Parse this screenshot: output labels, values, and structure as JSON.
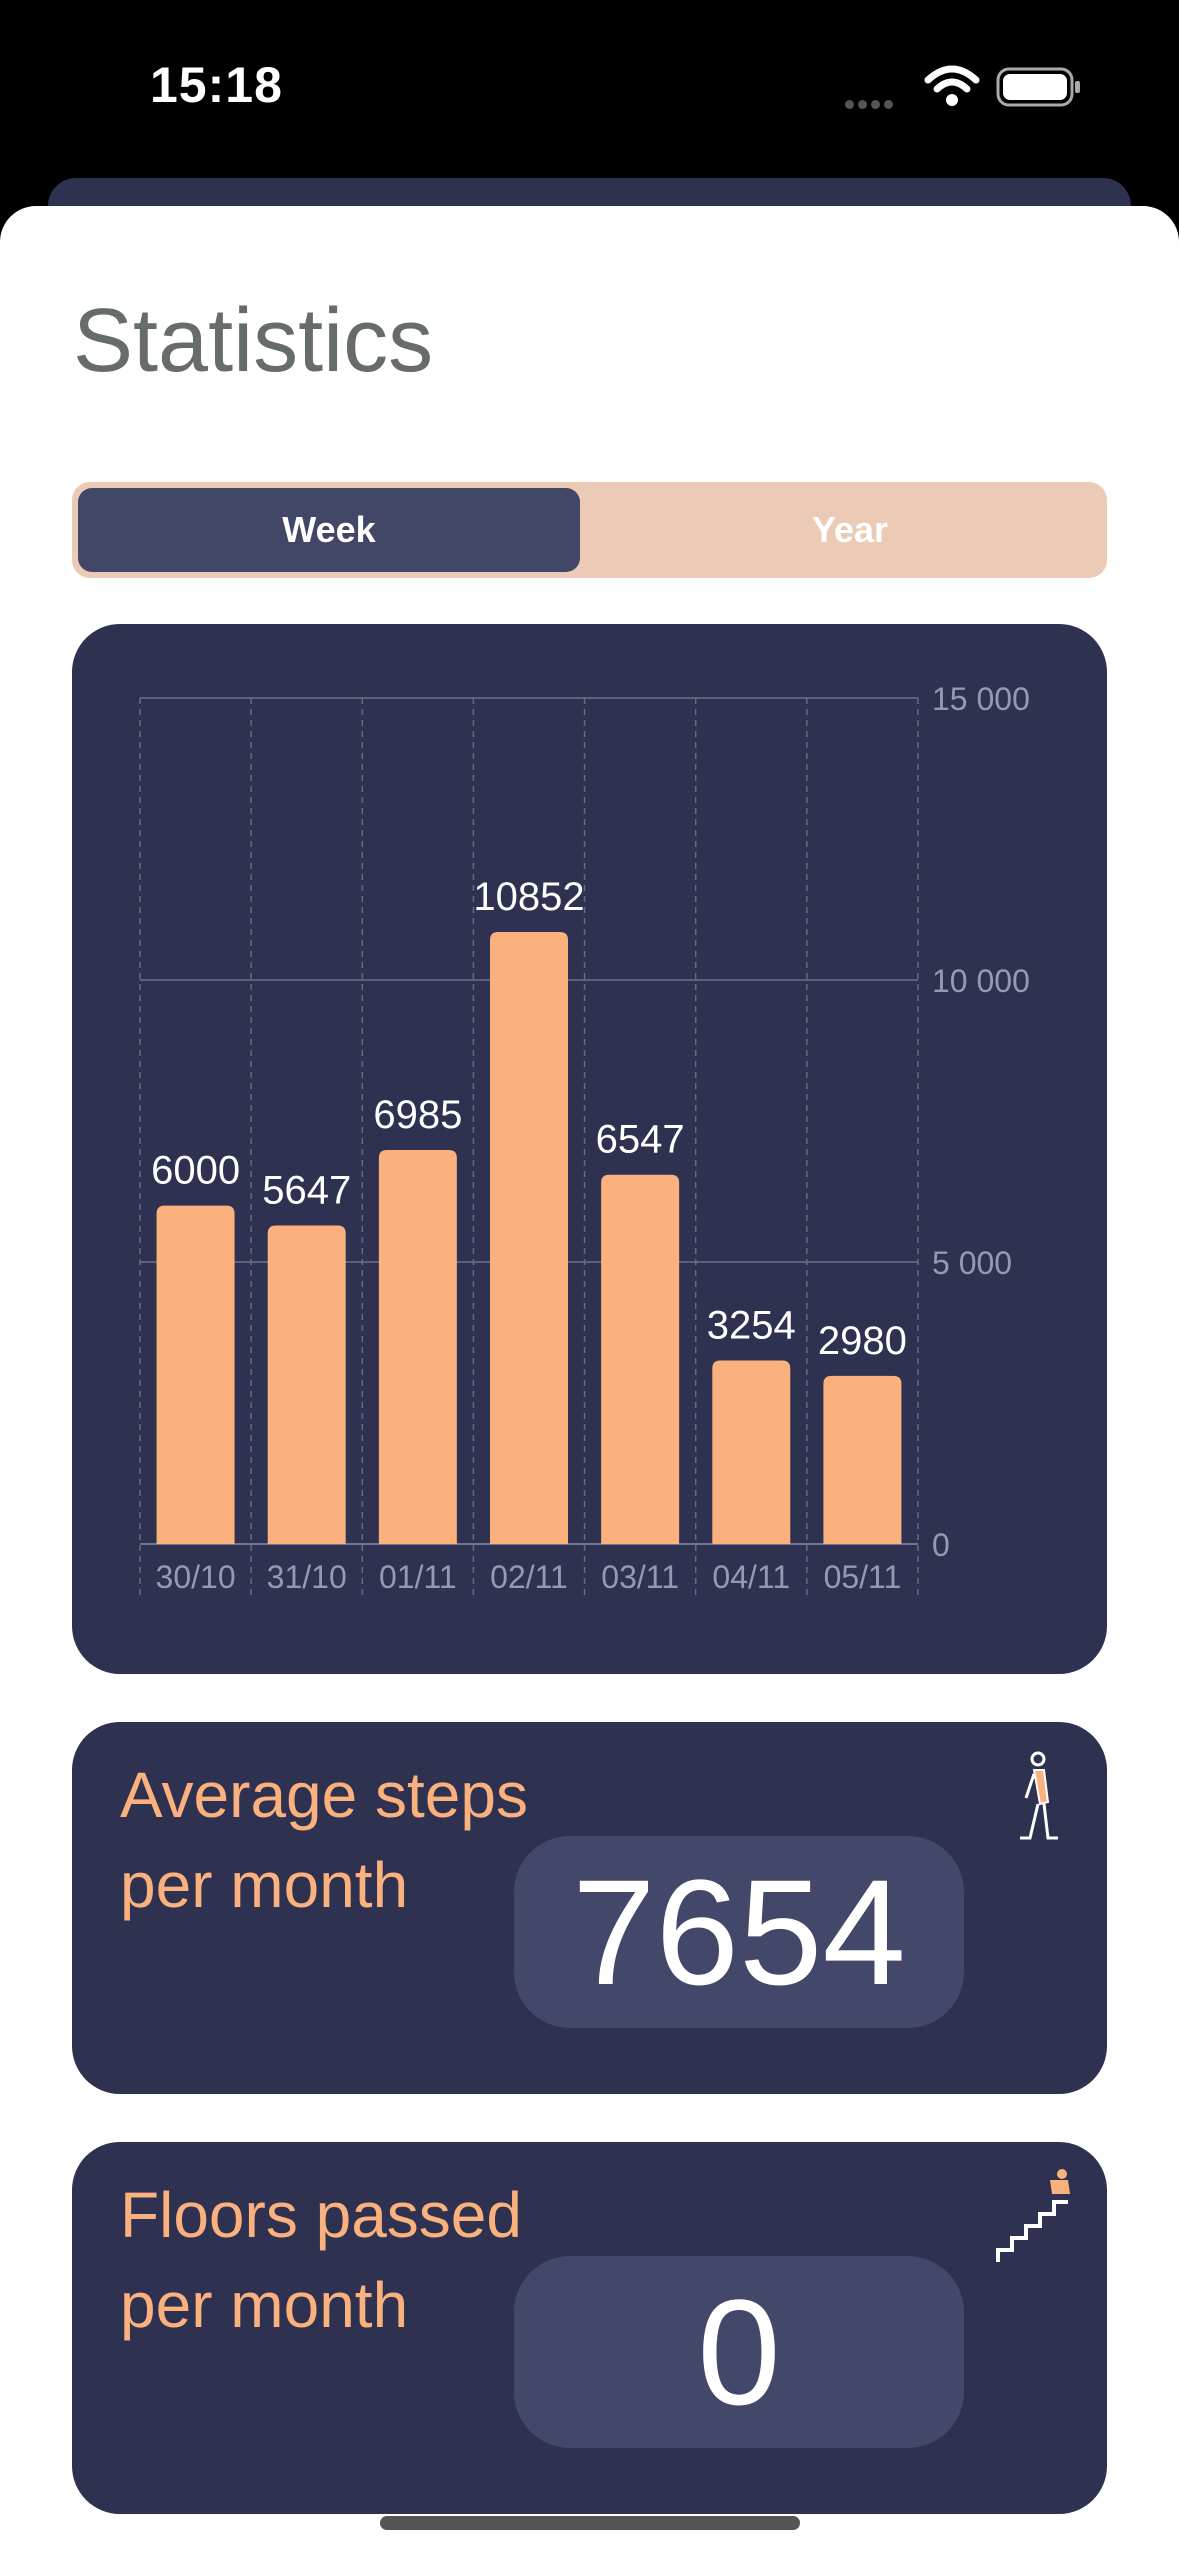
{
  "status_bar": {
    "time": "15:18"
  },
  "header": {
    "title": "Statistics"
  },
  "segments": {
    "week": "Week",
    "year": "Year",
    "selected": "Week"
  },
  "chart_data": {
    "type": "bar",
    "categories": [
      "30/10",
      "31/10",
      "01/11",
      "02/11",
      "03/11",
      "04/11",
      "05/11"
    ],
    "values": [
      6000,
      5647,
      6985,
      10852,
      6547,
      3254,
      2980
    ],
    "y_ticks": [
      "15 000",
      "10 000",
      "5 000",
      "0"
    ],
    "y_tick_values": [
      15000,
      10000,
      5000,
      0
    ],
    "ylim": [
      0,
      15000
    ],
    "grid": true,
    "bar_color": "#fbb17d",
    "title": "",
    "xlabel": "",
    "ylabel": ""
  },
  "steps_card": {
    "label_line1": "Average steps",
    "label_line2": "per month",
    "value": "7654",
    "icon": "walking-person-icon"
  },
  "floors_card": {
    "label_line1": "Floors passed",
    "label_line2": "per month",
    "value": "0",
    "icon": "stairs-icon"
  },
  "colors": {
    "accent": "#fbb17d",
    "card": "#2e3150",
    "selected_segment": "#424767",
    "segment_bg": "#ebcbb5"
  }
}
